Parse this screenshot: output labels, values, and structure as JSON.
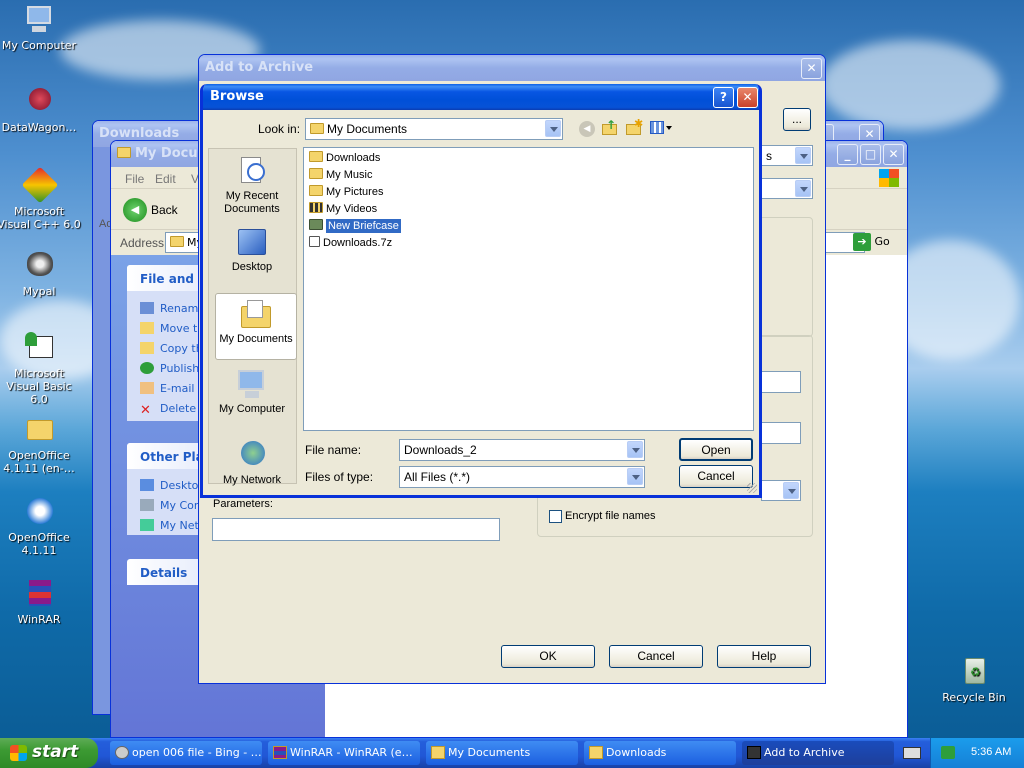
{
  "desktop": {
    "icons": [
      {
        "label": "My Computer"
      },
      {
        "label": "DataWagon…"
      },
      {
        "label": "Microsoft Visual C++ 6.0"
      },
      {
        "label": "Mypal"
      },
      {
        "label": "Microsoft Visual Basic 6.0"
      },
      {
        "label": "OpenOffice 4.1.11 (en-…"
      },
      {
        "label": "OpenOffice 4.1.11"
      },
      {
        "label": "WinRAR"
      },
      {
        "label": "Recycle Bin"
      }
    ]
  },
  "downloads_window": {
    "title": "Downloads",
    "address_partial": "Ad"
  },
  "mydocs_window": {
    "title": "My Docum",
    "menu": [
      "File",
      "Edit",
      "V"
    ],
    "back_label": "Back",
    "address_label": "Address",
    "address_value": "My",
    "go_label": "Go",
    "file_tasks_header": "File and Fo",
    "file_tasks": [
      "Renam",
      "Move th",
      "Copy th",
      "Publish",
      "E-mail t",
      "Delete"
    ],
    "other_places_header": "Other Plac",
    "other_places": [
      "Deskto",
      "My Con",
      "My Net"
    ],
    "details_header": "Details"
  },
  "archive_dialog": {
    "title": "Add to Archive",
    "browse_btn": "...",
    "parameters_label": "Parameters:",
    "parameters_value": "",
    "encrypt_label": "Encrypt file names",
    "ok": "OK",
    "cancel": "Cancel",
    "help": "Help",
    "partial_combo_text": "s"
  },
  "browse_dialog": {
    "title": "Browse",
    "help_btn": "?",
    "look_in_label": "Look in:",
    "look_in_value": "My Documents",
    "places": [
      "My Recent Documents",
      "Desktop",
      "My Documents",
      "My Computer",
      "My Network"
    ],
    "files": [
      {
        "name": "Downloads",
        "icon": "folder-icon"
      },
      {
        "name": "My Music",
        "icon": "music-folder-icon"
      },
      {
        "name": "My Pictures",
        "icon": "pictures-folder-icon"
      },
      {
        "name": "My Videos",
        "icon": "videos-folder-icon"
      },
      {
        "name": "New Briefcase",
        "icon": "briefcase-icon",
        "selected": true
      },
      {
        "name": "Downloads.7z",
        "icon": "archive-file-icon"
      }
    ],
    "file_name_label": "File name:",
    "file_name_value": "Downloads_2",
    "file_type_label": "Files of type:",
    "file_type_value": "All Files (*.*)",
    "open": "Open",
    "cancel": "Cancel"
  },
  "taskbar": {
    "start": "start",
    "tasks": [
      {
        "label": "open 006 file - Bing - …"
      },
      {
        "label": "WinRAR - WinRAR (e…"
      },
      {
        "label": "My Documents"
      },
      {
        "label": "Downloads"
      },
      {
        "label": "Add to Archive"
      }
    ],
    "clock": "5:36 AM"
  }
}
